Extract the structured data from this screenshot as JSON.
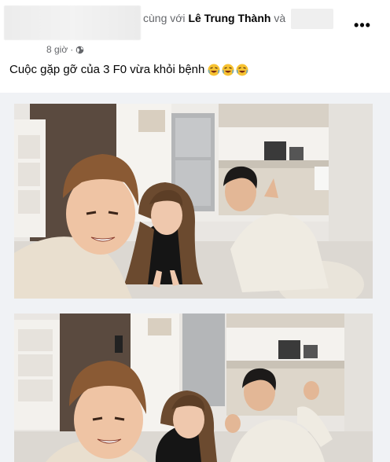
{
  "post": {
    "with_text": "cùng với",
    "tagged_person": "Lê Trung Thành",
    "and_text": "và",
    "time": "8 giờ",
    "separator": "·",
    "caption": "Cuộc gặp gỡ của 3 F0 vừa khỏi bệnh",
    "more_label": "•••"
  },
  "icons": {
    "privacy": "globe-icon",
    "more": "more-options-icon",
    "reaction": "rolling-laughing-emoji"
  },
  "colors": {
    "secondary_text": "#65676b",
    "primary_text": "#050505",
    "media_background": "#f0f2f5"
  }
}
